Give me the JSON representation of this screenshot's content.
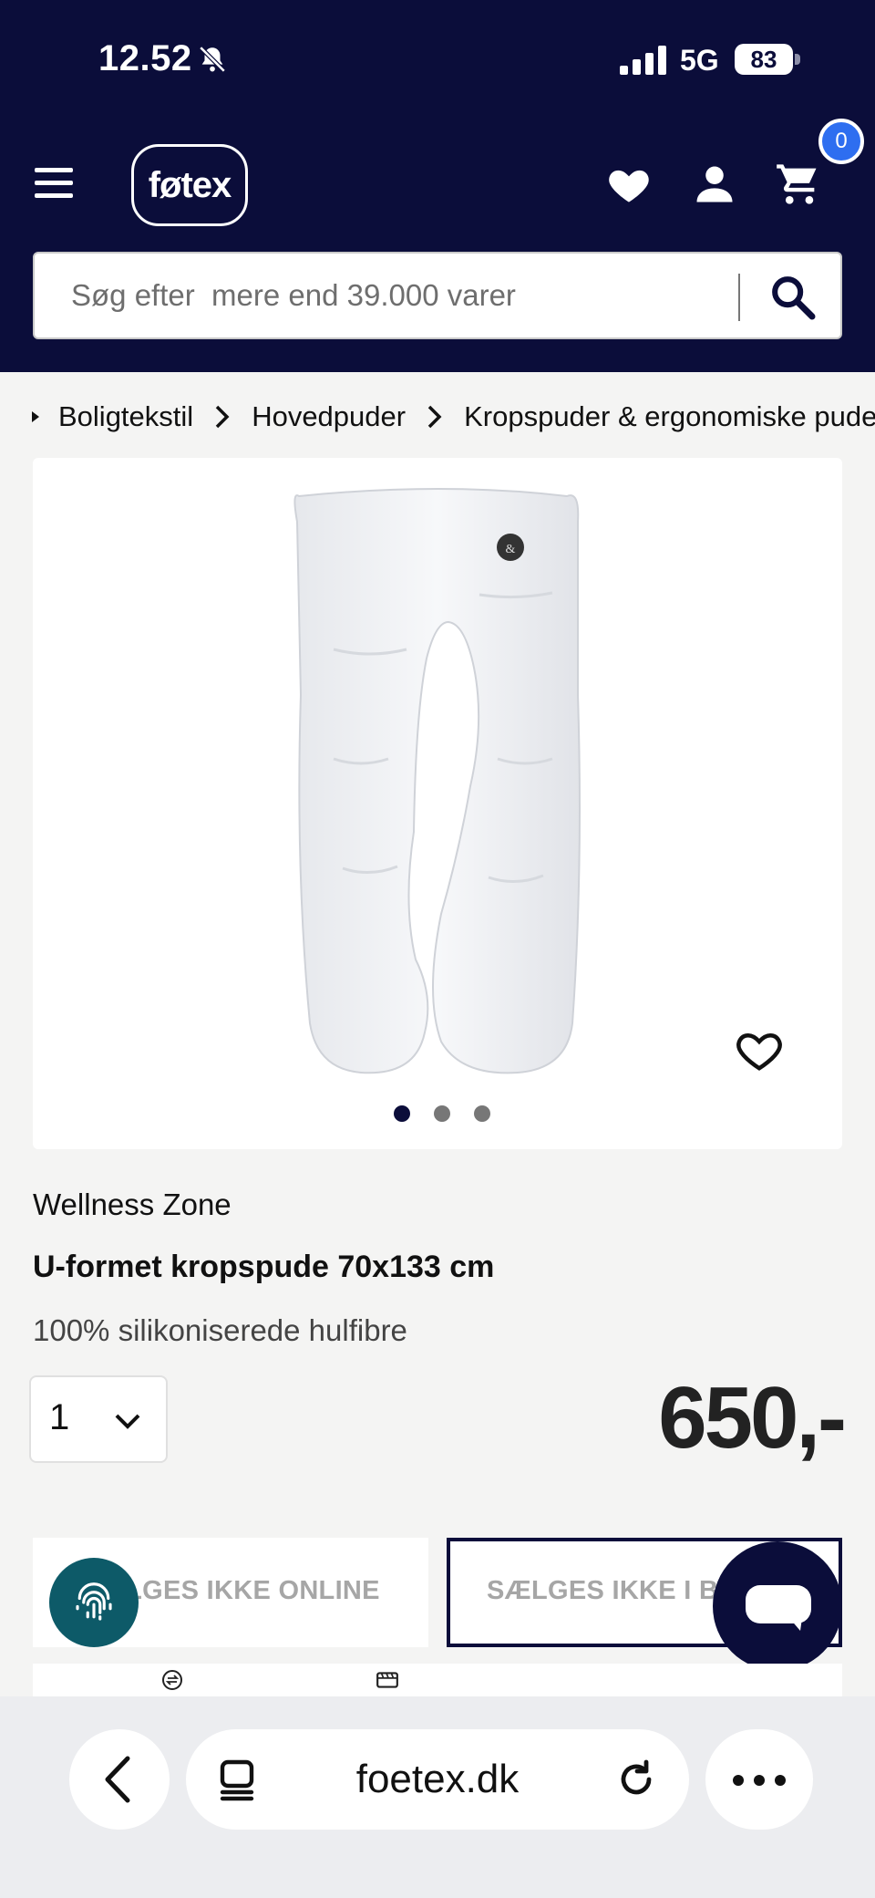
{
  "status_bar": {
    "time": "12.52",
    "network": "5G",
    "battery": "83"
  },
  "header": {
    "logo": "føtex",
    "cart_count": "0",
    "search_placeholder": "Søg efter  mere end 39.000 varer",
    "icons": [
      "menu-icon",
      "heart-icon",
      "user-icon",
      "cart-icon",
      "search-icon"
    ],
    "colors": {
      "header_bg": "#0b0d3a",
      "badge": "#2e6ef0"
    }
  },
  "breadcrumb": [
    "Boligtekstil",
    "Hovedpuder",
    "Kropspuder & ergonomiske puder"
  ],
  "product": {
    "brand": "Wellness Zone",
    "title": "U-formet kropspude 70x133 cm",
    "description": "100% silikoniserede hulfibre",
    "quantity": "1",
    "price": "650,-",
    "image_count": 3,
    "active_image": 1,
    "not_online_label": "SÆLGES IKKE ONLINE",
    "not_in_store_label": "SÆLGES IKKE I BUTIK"
  },
  "browser": {
    "url": "foetex.dk"
  }
}
